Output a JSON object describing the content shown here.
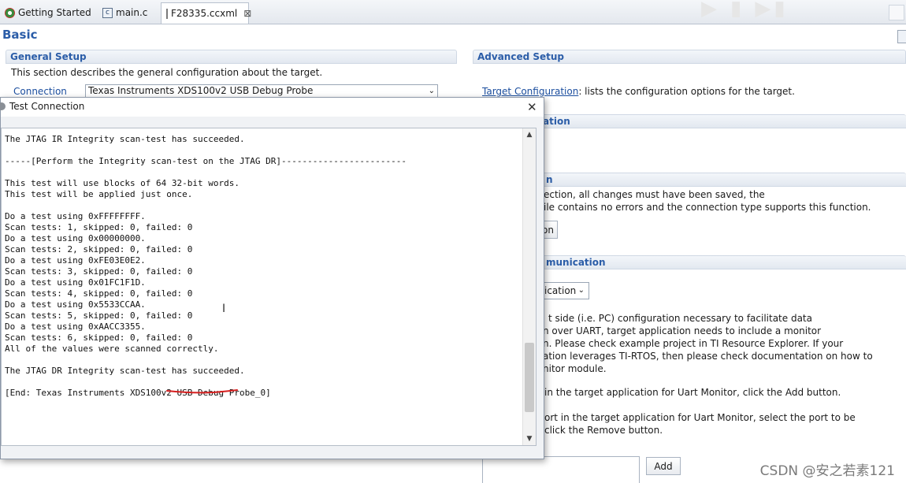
{
  "tabs": [
    {
      "label": "Getting Started",
      "icon": "getting-started-icon"
    },
    {
      "label": "main.c",
      "icon": "c-file-icon"
    },
    {
      "label": "F28335.ccxml",
      "icon": "ccxml-file-icon",
      "active": true,
      "close": "⊠"
    }
  ],
  "editor": {
    "title": "Basic",
    "general_setup": {
      "header": "General Setup",
      "description": "This section describes the general configuration about the target.",
      "connection_label": "Connection",
      "connection_value": "Texas Instruments XDS100v2 USB Debug Probe"
    },
    "advanced_setup": {
      "header": "Advanced Setup",
      "target_config_link": "Target Configuration",
      "target_config_text": ": lists the configuration options for the target.",
      "section2_header_fragment": "ation",
      "section3_header_fragment": "n",
      "save_line1": "ection, all changes must have been saved, the",
      "save_line2": "ile contains no errors and the connection type supports this function.",
      "test_button_fragment": "on",
      "comm_header_fragment": "munication",
      "dropdown_fragment": "ication",
      "para_lines": [
        "t side (i.e. PC) configuration necessary to facilitate data",
        "n over UART, target application needs to include a monitor",
        "n. Please check example project in TI Resource Explorer. If your",
        "ation leverages TI-RTOS, then please check documentation on how to",
        "nitor module."
      ],
      "add_text": "in the target application for Uart Monitor, click the Add button.",
      "remove_line1": "ort in the target application for Uart Monitor, select the port to be",
      "remove_line2": "click the Remove button.",
      "add_button": "Add"
    }
  },
  "dialog": {
    "title": "Test Connection",
    "close": "✕",
    "console_lines": [
      "The JTAG IR Integrity scan-test has succeeded.",
      "",
      "-----[Perform the Integrity scan-test on the JTAG DR]------------------------",
      "",
      "This test will use blocks of 64 32-bit words.",
      "This test will be applied just once.",
      "",
      "Do a test using 0xFFFFFFFF.",
      "Scan tests: 1, skipped: 0, failed: 0",
      "Do a test using 0x00000000.",
      "Scan tests: 2, skipped: 0, failed: 0",
      "Do a test using 0xFE03E0E2.",
      "Scan tests: 3, skipped: 0, failed: 0",
      "Do a test using 0x01FC1F1D.",
      "Scan tests: 4, skipped: 0, failed: 0",
      "Do a test using 0x5533CCAA.",
      "Scan tests: 5, skipped: 0, failed: 0",
      "Do a test using 0xAACC3355.",
      "Scan tests: 6, skipped: 0, failed: 0",
      "All of the values were scanned correctly.",
      "",
      "The JTAG DR Integrity scan-test has succeeded.",
      "",
      "[End: Texas Instruments XDS100v2 USB Debug Probe_0]"
    ],
    "scroll_up": "▲",
    "scroll_down": "▼"
  },
  "watermark": "CSDN @安之若素121",
  "colors": {
    "accent": "#2b5da8",
    "underline_annotation": "#d62020"
  }
}
